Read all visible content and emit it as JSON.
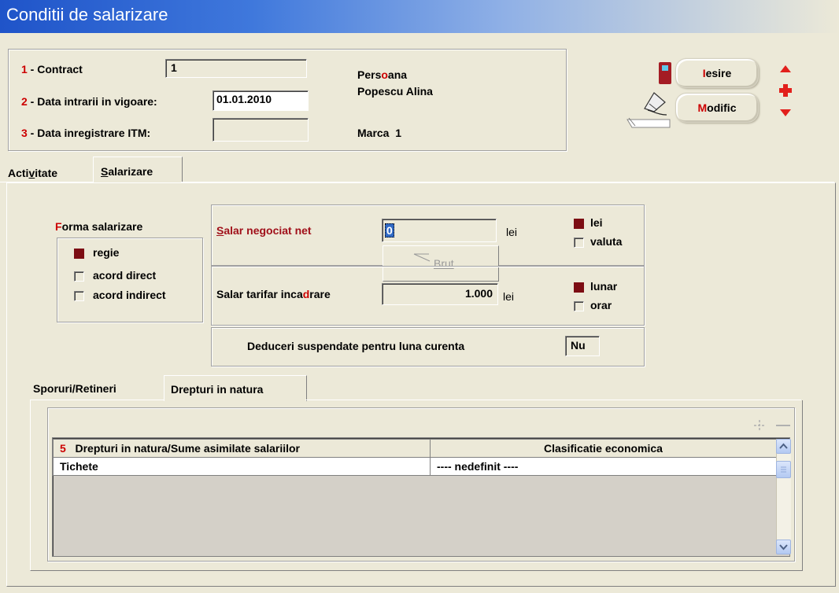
{
  "window": {
    "title": "Conditii de salarizare"
  },
  "header": {
    "contract": {
      "prefix": "1",
      "label": " - Contract",
      "value": "1"
    },
    "data_intrarii": {
      "prefix": "2",
      "label": " - Data intrarii in vigoare:",
      "value": "01.01.2010"
    },
    "data_itm": {
      "prefix": "3",
      "label": " - Data inregistrare ITM:",
      "value": ""
    },
    "persoana": {
      "label_a": "Pers",
      "label_hot": "o",
      "label_b": "ana",
      "name": "Popescu Alina"
    },
    "marca": {
      "label": "Marca",
      "value": "1"
    }
  },
  "toolbar": {
    "iesire": {
      "hot": "I",
      "rest": "esire"
    },
    "modific": {
      "hot": "M",
      "rest": "odific"
    }
  },
  "tabs": [
    {
      "a": "Acti",
      "hot": "v",
      "b": "itate"
    },
    {
      "a": "",
      "hot": "S",
      "b": "alarizare"
    }
  ],
  "forma": {
    "title_hot": "F",
    "title_rest": "orma salarizare",
    "options": [
      "regie",
      "acord direct",
      "acord indirect"
    ],
    "selected": 0
  },
  "salar_negociat": {
    "hot": "S",
    "rest": "alar negociat net",
    "value": "0",
    "unit": "lei",
    "brut_label": "Brut"
  },
  "moneda": {
    "options": [
      "lei",
      "valuta"
    ],
    "selected": 0
  },
  "salar_tarifar": {
    "a": "Salar tarifar inca",
    "hot": "d",
    "b": "rare",
    "value": "1.000",
    "unit": "lei"
  },
  "perioada": {
    "options": [
      "lunar",
      "orar"
    ],
    "selected": 0
  },
  "deduceri": {
    "label": "Deduceri suspendate pentru luna curenta",
    "value": "Nu"
  },
  "subtabs": [
    "Sporuri/Retineri",
    "Drepturi in natura"
  ],
  "grid": {
    "num": "5",
    "col1": "Drepturi in natura/Sume asimilate salariilor",
    "col2": "Clasificatie economica",
    "rows": [
      {
        "c1": "Tichete",
        "c2": "---- nedefinit ----"
      }
    ]
  },
  "colors": {
    "accent_red": "#cc0000",
    "radio_fill": "#7c0d13",
    "title_blue": "#1f54c9"
  }
}
